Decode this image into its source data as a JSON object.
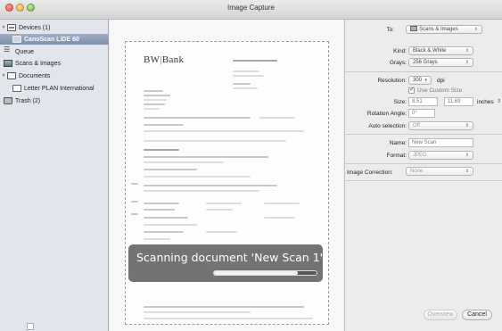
{
  "window": {
    "title": "Image Capture"
  },
  "sidebar": {
    "devices_header": "Devices (1)",
    "device": "CanoScan LiDE 60",
    "items": [
      {
        "label": "Queue",
        "icon": "queue-icon"
      },
      {
        "label": "Scans & Images",
        "icon": "picture-icon"
      }
    ],
    "documents_header": "Documents",
    "document_item": "Letter PLAN International",
    "trash": "Trash (2)"
  },
  "document": {
    "logo_left": "BW",
    "logo_sep": "|",
    "logo_right": "Bank"
  },
  "scan_overlay": {
    "message": "Scanning document 'New Scan 1'",
    "progress": 0.82
  },
  "panel": {
    "to_label": "To:",
    "to_value": "Scans & Images",
    "kind_label": "Kind:",
    "kind_value": "Black & White",
    "grays_label": "Grays:",
    "grays_value": "256 Grays",
    "resolution_label": "Resolution:",
    "resolution_value": "300",
    "resolution_unit": "dpi",
    "custom_size_label": "Use Custom Size",
    "custom_size_checked": true,
    "size_label": "Size:",
    "size_width": "8.51",
    "size_height": "11.69",
    "size_unit": "inches",
    "rotation_label": "Rotation Angle:",
    "rotation_value": "0°",
    "auto_selection_label": "Auto selection:",
    "auto_selection_value": "Off",
    "name_label": "Name:",
    "name_value": "New Scan",
    "format_label": "Format:",
    "format_value": "JPEG",
    "image_correction_label": "Image Correction:",
    "image_correction_value": "None",
    "overview_button": "Overview",
    "cancel_button": "Cancel"
  }
}
